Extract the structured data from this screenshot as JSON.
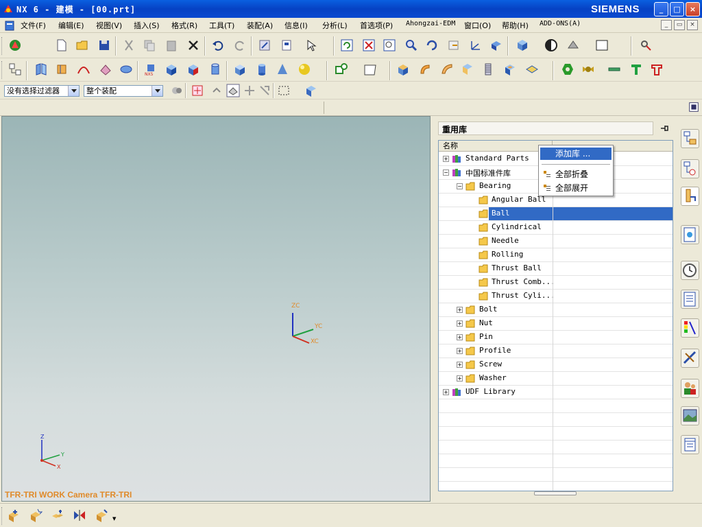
{
  "window": {
    "title": "NX 6 - 建模 - [00.prt]",
    "brand": "SIEMENS",
    "controls": [
      "_",
      "□",
      "×"
    ]
  },
  "menubar": {
    "items": [
      "文件(F)",
      "编辑(E)",
      "视图(V)",
      "插入(S)",
      "格式(R)",
      "工具(T)",
      "装配(A)",
      "信息(I)",
      "分析(L)",
      "首选项(P)",
      "Ahongzai-EDM",
      "窗口(O)",
      "帮助(H)",
      "ADD-ONS(A)"
    ],
    "start_label": "开始"
  },
  "selection_bar": {
    "filter_value": "没有选择过滤器",
    "scope_value": "整个装配"
  },
  "viewport": {
    "label": "TFR-TRI WORK Camera TFR-TRI",
    "axis_zc": "ZC",
    "axis_yc": "YC",
    "axis_xc": "XC",
    "axis_z": "Z",
    "axis_y": "Y",
    "axis_x": "X"
  },
  "reuse_library": {
    "title": "重用库",
    "column_name": "名称",
    "tree": [
      {
        "label": "Standard Parts",
        "expander": "+",
        "icon": "library-icon",
        "level": 0
      },
      {
        "label": "中国标准件库",
        "expander": "−",
        "icon": "library-icon",
        "level": 0
      },
      {
        "label": "Bearing",
        "expander": "−",
        "icon": "folder-icon",
        "level": 1
      },
      {
        "label": "Angular Ball",
        "expander": "",
        "icon": "folder-icon",
        "level": 2
      },
      {
        "label": "Ball",
        "expander": "",
        "icon": "folder-icon",
        "level": 2,
        "selected": true
      },
      {
        "label": "Cylindrical",
        "expander": "",
        "icon": "folder-icon",
        "level": 2
      },
      {
        "label": "Needle",
        "expander": "",
        "icon": "folder-icon",
        "level": 2
      },
      {
        "label": "Rolling",
        "expander": "",
        "icon": "folder-icon",
        "level": 2
      },
      {
        "label": "Thrust Ball",
        "expander": "",
        "icon": "folder-icon",
        "level": 2
      },
      {
        "label": "Thrust Comb...",
        "expander": "",
        "icon": "folder-icon",
        "level": 2
      },
      {
        "label": "Thrust Cyli...",
        "expander": "",
        "icon": "folder-icon",
        "level": 2
      },
      {
        "label": "Bolt",
        "expander": "+",
        "icon": "folder-icon",
        "level": 1
      },
      {
        "label": "Nut",
        "expander": "+",
        "icon": "folder-icon",
        "level": 1
      },
      {
        "label": "Pin",
        "expander": "+",
        "icon": "folder-icon",
        "level": 1
      },
      {
        "label": "Profile",
        "expander": "+",
        "icon": "folder-icon",
        "level": 1
      },
      {
        "label": "Screw",
        "expander": "+",
        "icon": "folder-icon",
        "level": 1
      },
      {
        "label": "Washer",
        "expander": "+",
        "icon": "folder-icon",
        "level": 1
      },
      {
        "label": "UDF Library",
        "expander": "+",
        "icon": "library-icon",
        "level": 0
      }
    ]
  },
  "context_menu": {
    "items": [
      "添加库 ...",
      "全部折叠",
      "全部展开"
    ]
  },
  "colors": {
    "titlebar": "#0a4ad0",
    "selection": "#316ac5",
    "viewport_label": "#e08a2a",
    "axis_z": "#2030c0",
    "axis_y": "#20a040",
    "axis_x": "#d03020"
  }
}
